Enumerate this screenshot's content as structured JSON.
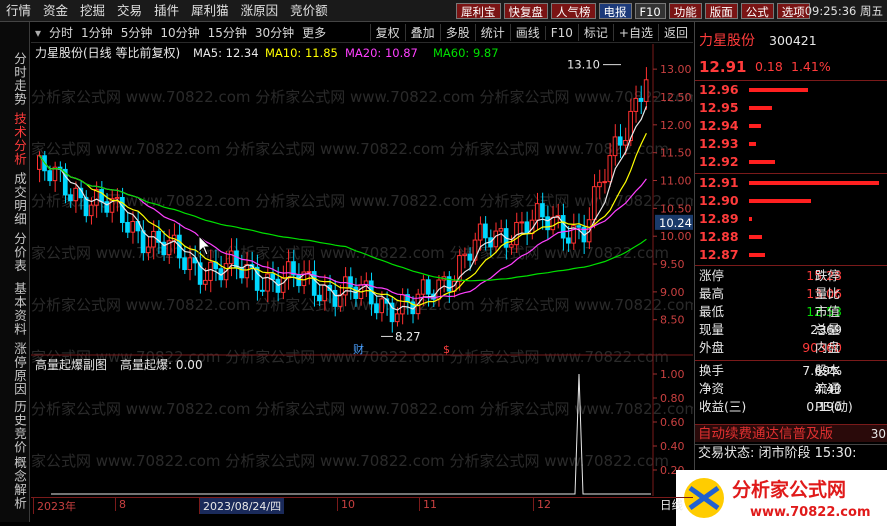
{
  "menu": [
    "行情",
    "资金",
    "挖掘",
    "交易",
    "插件",
    "犀利猫",
    "涨原因",
    "竞价额"
  ],
  "hot_tabs": [
    {
      "label": "犀利宝",
      "kind": "red"
    },
    {
      "label": "快复盘",
      "kind": "red"
    },
    {
      "label": "人气榜",
      "kind": "red"
    },
    {
      "label": "电报",
      "kind": "blue"
    },
    {
      "label": "F10",
      "kind": "plain"
    },
    {
      "label": "功能",
      "kind": "red"
    },
    {
      "label": "版面",
      "kind": "red"
    },
    {
      "label": "公式",
      "kind": "red"
    },
    {
      "label": "选项",
      "kind": "red"
    }
  ],
  "clock": "09:25:36 周五",
  "left_tabs": [
    "分时走势",
    "技术分析",
    "成交明细",
    "分价表",
    "基本资料",
    "涨停原因",
    "历史竞价",
    "概念解析"
  ],
  "active_left_tab": "技术分析",
  "periods": [
    "分时",
    "1分钟",
    "5分钟",
    "10分钟",
    "15分钟",
    "30分钟",
    "更多"
  ],
  "toolbar": [
    "复权",
    "叠加",
    "多股",
    "统计",
    "画线",
    "F10",
    "标记",
    "+自选",
    "返回"
  ],
  "main_chart": {
    "title": "力星股份(日线 等比前复权)",
    "ma": [
      {
        "label": "MA5: 12.34",
        "color": "#e8e8e8"
      },
      {
        "label": "MA10: 11.85",
        "color": "#ffff00"
      },
      {
        "label": "MA20: 10.87",
        "color": "#ff40ff"
      },
      {
        "label": "MA60: 9.87",
        "color": "#00e000"
      }
    ],
    "high_label": "13.10",
    "low_label": "8.27",
    "current_price_tag": "10.24",
    "event_markers": [
      "财",
      "$"
    ],
    "yticks": [
      "13.00",
      "12.50",
      "12.00",
      "11.50",
      "11.00",
      "10.50",
      "10.00",
      "9.50",
      "9.00",
      "8.50"
    ]
  },
  "sub_chart": {
    "title": "高量起爆副图",
    "value_label": "高量起爆: 0.00",
    "yticks": [
      "1.00",
      "0.80",
      "0.60",
      "0.40",
      "0.20"
    ]
  },
  "xaxis": {
    "labels": [
      "2023年",
      "8",
      "2023/08/24/四",
      "10",
      "11",
      "12"
    ],
    "right_label": "日线"
  },
  "watermark": "分析家公式网 www.70822.com",
  "quote": {
    "name": "力星股份",
    "code": "300421",
    "price": "12.91",
    "change": "0.18",
    "pct": "1.41%",
    "asks": [
      {
        "price": "12.96",
        "fill": 0.45
      },
      {
        "price": "12.95",
        "fill": 0.18
      },
      {
        "price": "12.94",
        "fill": 0.09
      },
      {
        "price": "12.93",
        "fill": 0.05
      },
      {
        "price": "12.92",
        "fill": 0.2
      }
    ],
    "bids": [
      {
        "price": "12.91",
        "fill": 1.0
      },
      {
        "price": "12.90",
        "fill": 0.48
      },
      {
        "price": "12.89",
        "fill": 0.02
      },
      {
        "price": "12.88",
        "fill": 0.1
      },
      {
        "price": "12.87",
        "fill": 0.12
      }
    ],
    "stats": [
      {
        "l": "涨停",
        "v": "15.28",
        "vc": "red",
        "r": "跌停"
      },
      {
        "l": "最高",
        "v": "13.06",
        "vc": "red",
        "r": "量比"
      },
      {
        "l": "最低",
        "v": "12.53",
        "vc": "green",
        "r": "市值"
      },
      {
        "l": "现量",
        "v": "2369",
        "vc": "wht",
        "r": "总量"
      },
      {
        "l": "外盘",
        "v": "90360",
        "vc": "red",
        "r": "内盘"
      }
    ],
    "stats2": [
      {
        "l": "换手",
        "v": "7.69%",
        "vc": "wht",
        "r": "股本"
      },
      {
        "l": "净资",
        "v": "4.43",
        "vc": "wht",
        "r": "流通"
      },
      {
        "l": "收益(三)",
        "v": "0.190",
        "vc": "wht",
        "r": "PE(动)"
      }
    ],
    "promo": "自动续费通达信普及版",
    "promo_right": "30",
    "trade_state": "交易状态: 闭市阶段 15:30:",
    "logo_text": "分析家公式网",
    "logo_url": "www.70822.com"
  }
}
